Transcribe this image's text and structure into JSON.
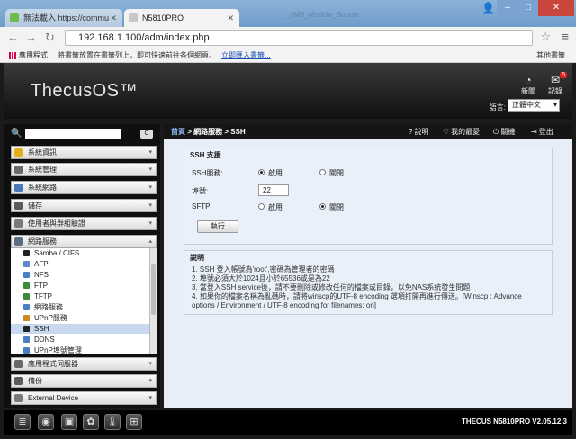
{
  "browser": {
    "tabs": [
      {
        "title": "無法載入 https://commu",
        "fav_color": "#6dbb4a"
      },
      {
        "title": "N5810PRO",
        "fav_color": "#c8c8c8"
      }
    ],
    "ghost_tab": "_JMB_Module_Source",
    "address": "192.168.1.100/adm/index.php",
    "bookmarks": {
      "apps": "應用程式",
      "hint": "將書籤放置在書籤列上，即可快速前往各個網頁。",
      "import_link": "立即匯入書籤...",
      "other": "其他書籤"
    },
    "icons": {
      "back": "arrow-left-icon",
      "forward": "arrow-right-icon",
      "reload": "reload-icon",
      "star": "star-icon",
      "menu": "hamburger-icon"
    }
  },
  "header": {
    "logo": "ThecusOS™",
    "news": "新聞",
    "log": "記錄",
    "log_badge": "5",
    "language_label": "語言:",
    "language_value": "正體中文"
  },
  "sidebar": {
    "search_placeholder": "",
    "clear_label": "C",
    "items": [
      {
        "label": "系統資訊",
        "icon_color": "#e3b21a"
      },
      {
        "label": "系統管理",
        "icon_color": "#6a6a6a"
      },
      {
        "label": "系統網路",
        "icon_color": "#4a77b8"
      },
      {
        "label": "儲存",
        "icon_color": "#5a5a5a"
      },
      {
        "label": "使用者與群組驗證",
        "icon_color": "#7a7a7a"
      },
      {
        "label": "網路服務",
        "icon_color": "#5d6d86"
      }
    ],
    "submenu": [
      {
        "label": "Samba / CIFS",
        "icon_color": "#222"
      },
      {
        "label": "AFP",
        "icon_color": "#5a8bd0"
      },
      {
        "label": "NFS",
        "icon_color": "#4b7fc4"
      },
      {
        "label": "FTP",
        "icon_color": "#3c8a3c"
      },
      {
        "label": "TFTP",
        "icon_color": "#3c8a3c"
      },
      {
        "label": "網路服務",
        "icon_color": "#4b7fc4"
      },
      {
        "label": "UPnP服務",
        "icon_color": "#d08a22"
      },
      {
        "label": "SSH",
        "icon_color": "#222",
        "selected": true
      },
      {
        "label": "DDNS",
        "icon_color": "#4b7fc4"
      },
      {
        "label": "UPnP埠號管理",
        "icon_color": "#4b7fc4"
      }
    ],
    "items_bottom": [
      {
        "label": "應用程式伺服器",
        "icon_color": "#6a6a6a"
      },
      {
        "label": "備份",
        "icon_color": "#5a5a5a"
      },
      {
        "label": "External Device",
        "icon_color": "#7a7a7a"
      }
    ]
  },
  "main": {
    "breadcrumb_home": "首頁",
    "breadcrumb_rest": "> 網路服務 > SSH",
    "top_links": {
      "help": "說明",
      "favorites": "我的最愛",
      "shutdown": "關機",
      "logout": "登出"
    },
    "ssh_panel": {
      "title": "SSH 支援",
      "service_label": "SSH服務:",
      "enable_label": "啟用",
      "disable_label": "關閉",
      "service_value": "啟用",
      "port_label": "埠號:",
      "port_value": "22",
      "sftp_label": "SFTP:",
      "sftp_value": "關閉",
      "apply_button": "執行"
    },
    "notes_panel": {
      "title": "說明",
      "lines": [
        "1. SSH 登入帳號為'root',密碼為管理者的密碼",
        "2. 埠號必須大於1024且小於65536或是為22",
        "3. 當登入SSH service後，請不要刪除或修改任何的檔案或目錄，以免NAS系統發生問題",
        "4. 如果你的檔案名稱為亂碼時，請將winscp的UTF-8 encoding 選項打開再進行傳送。[Winscp : Advance",
        "options / Environment / UTF-8 encoding for filenames: on]"
      ]
    }
  },
  "bottombar": {
    "icons": [
      "server-icon",
      "disk-icon",
      "app-icon",
      "media-icon",
      "temperature-icon",
      "network-icon"
    ],
    "version": "THECUS N5810PRO V2.05.12.3"
  }
}
